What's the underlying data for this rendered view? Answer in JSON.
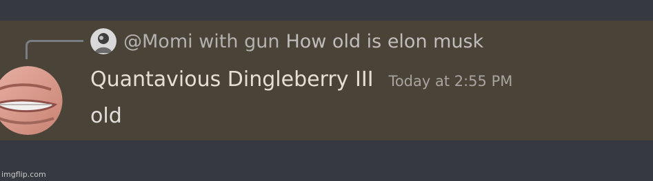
{
  "reply": {
    "author": "@Momi with gun",
    "text": "How old is elon musk",
    "avatar_icon": "user-avatar-icon"
  },
  "message": {
    "username": "Quantavious Dingleberry III",
    "timestamp": "Today at 2:55 PM",
    "content": "old",
    "avatar_icon": "user-avatar-icon"
  },
  "watermark": "imgflip.com",
  "colors": {
    "page_background": "#363940",
    "message_background": "#4a4438",
    "username": "#e6dfd6",
    "muted_text": "#a8a49f"
  }
}
